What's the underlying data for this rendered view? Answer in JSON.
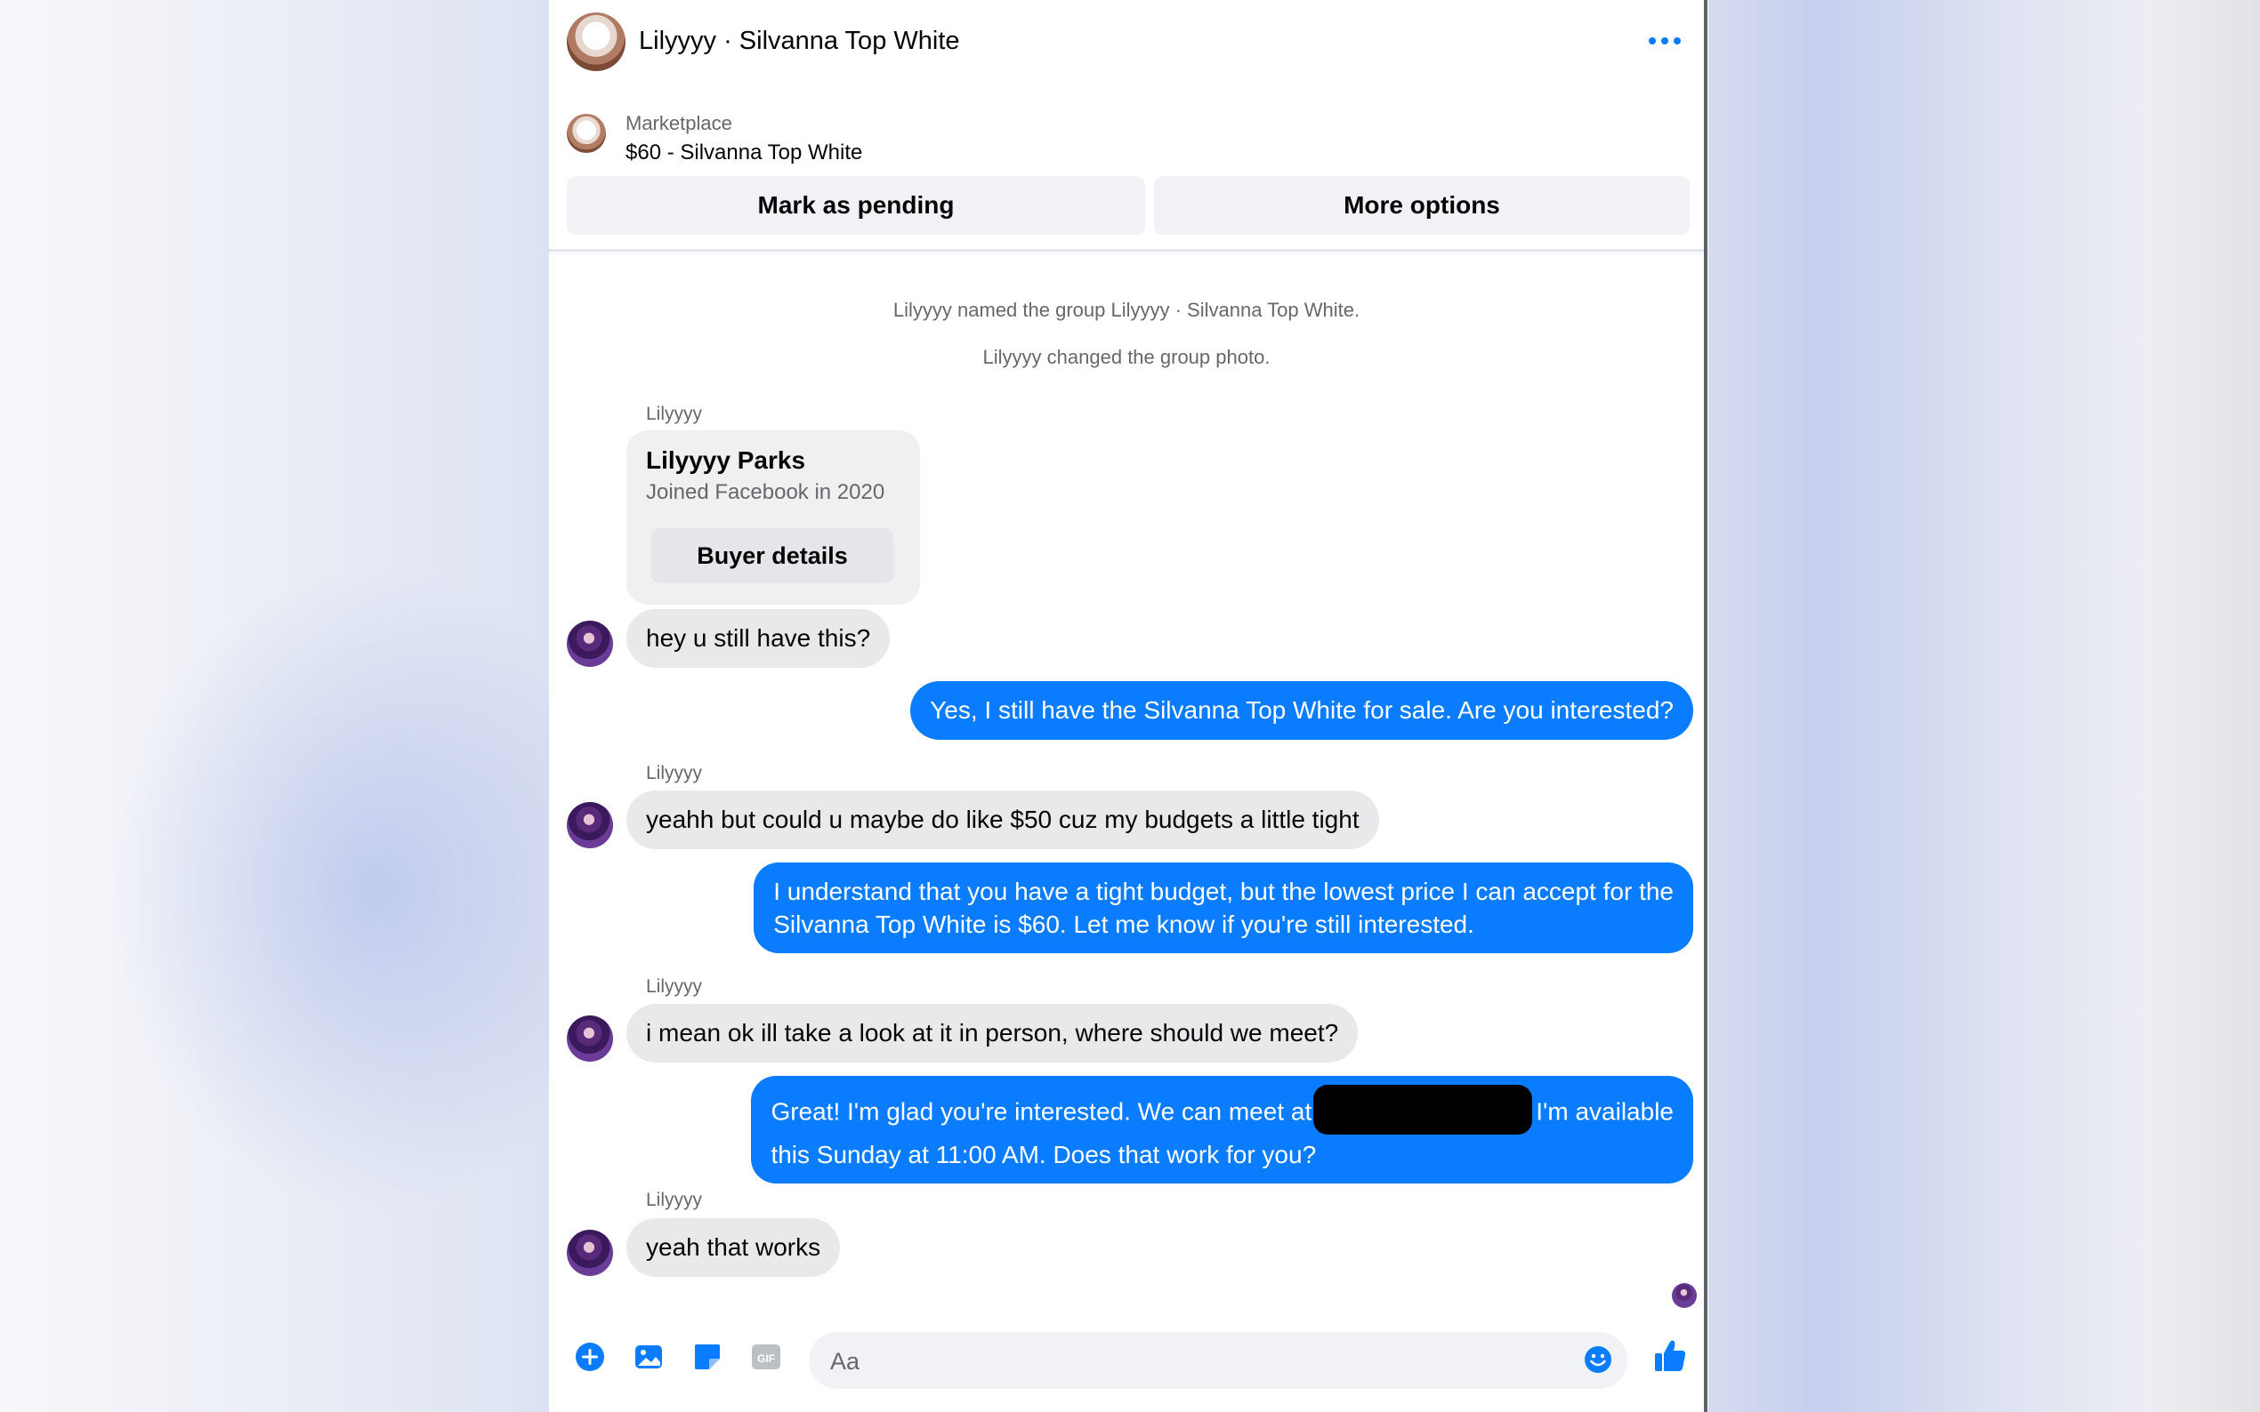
{
  "header": {
    "title": "Lilyyyy · Silvanna Top White"
  },
  "marketplace": {
    "label": "Marketplace",
    "item": "$60 - Silvanna Top White",
    "mark_pending_label": "Mark as pending",
    "more_options_label": "More options"
  },
  "system_messages": [
    "Lilyyyy named the group Lilyyyy · Silvanna Top White.",
    "Lilyyyy changed the group photo."
  ],
  "buyer_card": {
    "name": "Lilyyyy Parks",
    "joined": "Joined Facebook in 2020",
    "button_label": "Buyer details"
  },
  "messages": [
    {
      "from": "Lilyyyy",
      "sender_label": "Lilyyyy",
      "text": "hey u still have this?"
    },
    {
      "from": "me",
      "text": "Yes, I still have the Silvanna Top White for sale. Are you interested?"
    },
    {
      "from": "Lilyyyy",
      "sender_label": "Lilyyyy",
      "text": "yeahh but could u maybe do like $50 cuz my budgets a little tight"
    },
    {
      "from": "me",
      "line1": "I understand that you have a tight budget, but the lowest price I can accept for the",
      "line2": "Silvanna Top White is $60. Let me know if you're still interested."
    },
    {
      "from": "Lilyyyy",
      "sender_label": "Lilyyyy",
      "text": "i mean ok ill take a look at it in person, where should we meet?"
    },
    {
      "from": "me",
      "line1_a": "Great! I'm glad you're interested. We can meet at",
      "line1_b": "I'm available",
      "line2": "this Sunday at 11:00 AM. Does that work for you?"
    },
    {
      "from": "Lilyyyy",
      "sender_label": "Lilyyyy",
      "text": "yeah that works"
    }
  ],
  "composer": {
    "placeholder": "Aa"
  },
  "icons": {
    "more": "more-horizontal-icon",
    "add": "plus-circle-icon",
    "photo": "photo-icon",
    "sticker": "sticker-icon",
    "gif": "gif-icon",
    "emoji": "emoji-icon",
    "like": "thumbs-up-icon"
  },
  "colors": {
    "accent": "#0a7cff",
    "incoming_bubble": "#e9e9eb",
    "outgoing_bubble": "#0a7cff"
  }
}
